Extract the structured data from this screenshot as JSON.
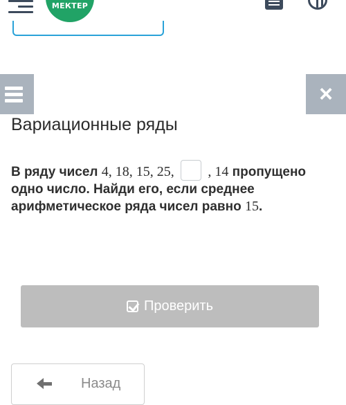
{
  "header": {
    "logo_text": "МЕКТЕР",
    "icons": [
      "menu-icon",
      "logo",
      "list-icon",
      "globe-icon"
    ]
  },
  "sidebar_toggle": {
    "icon": "hamburger-icon"
  },
  "close": {
    "icon": "close-icon",
    "label": "×"
  },
  "lesson": {
    "title": "Вариационные ряды"
  },
  "task": {
    "lead": "В ряду чисел",
    "numbers_before": "4, 18, 15, 25,",
    "answer_value": "",
    "numbers_after": ", 14",
    "text_middle": "пропущено одно число. Найди его, если среднее арифметическое ряда чисел равно",
    "mean_value": "15",
    "end_punct": "."
  },
  "actions": {
    "check_label": "Проверить",
    "back_label": "Назад"
  },
  "colors": {
    "brand_green": "#21a366",
    "gray_button": "#aab3bd",
    "check_button": "#bdbdbd",
    "accent_blue": "#29a2d8"
  }
}
